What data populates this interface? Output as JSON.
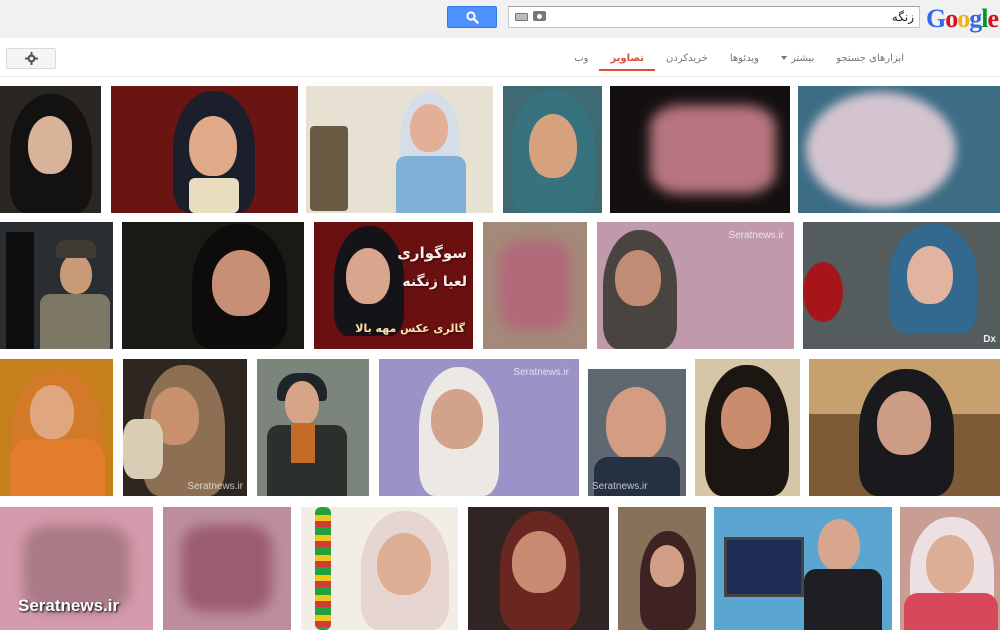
{
  "search": {
    "query": "زنگه",
    "button_icon": "search-icon"
  },
  "logo": {
    "letters": [
      "G",
      "o",
      "o",
      "g",
      "l",
      "e"
    ]
  },
  "nav": {
    "tabs": [
      {
        "label": "وب",
        "active": false
      },
      {
        "label": "تصاویر",
        "active": true
      },
      {
        "label": "خریدکردن",
        "active": false
      },
      {
        "label": "ویدئوها",
        "active": false
      },
      {
        "label": "بیشتر",
        "active": false,
        "has_dropdown": true
      },
      {
        "label": "ابزارهای جستجو",
        "active": false
      }
    ]
  },
  "colors": {
    "accent_red": "#dd4b39",
    "search_blue": "#4d90fe",
    "topbar": "#f1f1f1"
  },
  "overlay_poster": {
    "lines": [
      "سوگواری",
      "لعیا زنگنه",
      "گالری عکس مهه بالا"
    ]
  },
  "watermarks": {
    "seratnews": "Seratnews.ir",
    "seratnews_large": "Seratnews.ir",
    "dx": "Dx"
  }
}
